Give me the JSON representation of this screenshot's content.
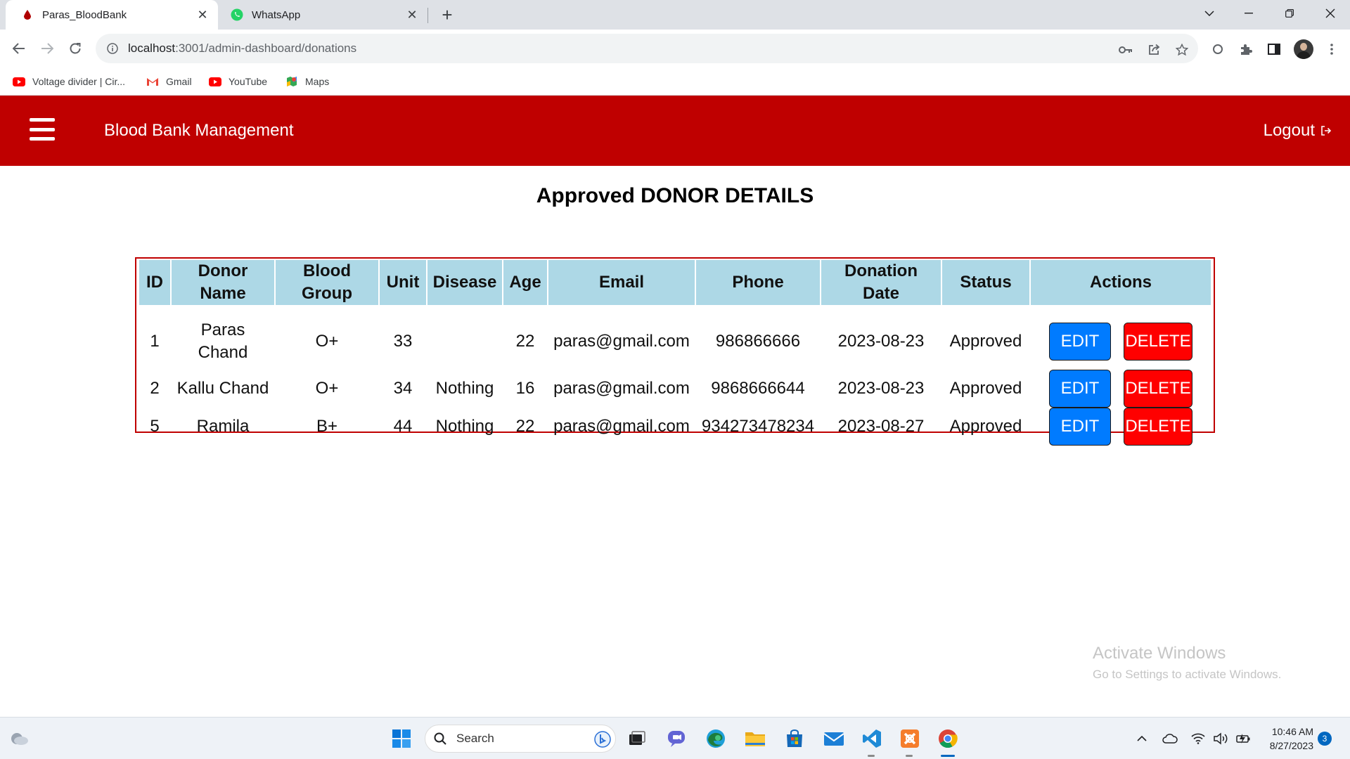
{
  "browser": {
    "tabs": [
      {
        "title": "Paras_BloodBank",
        "icon": "blood-drop-icon",
        "active": true
      },
      {
        "title": "WhatsApp",
        "icon": "whatsapp-icon",
        "active": false
      }
    ],
    "url_host": "localhost",
    "url_path": ":3001/admin-dashboard/donations",
    "bookmarks": [
      {
        "label": "Voltage divider | Cir...",
        "icon": "youtube-icon"
      },
      {
        "label": "Gmail",
        "icon": "gmail-icon"
      },
      {
        "label": "YouTube",
        "icon": "youtube-icon"
      },
      {
        "label": "Maps",
        "icon": "maps-icon"
      }
    ]
  },
  "header": {
    "brand": "Blood Bank Management",
    "logout_label": "Logout"
  },
  "page": {
    "title": "Approved DONOR DETAILS"
  },
  "table": {
    "headers": [
      "ID",
      "Donor Name",
      "Blood Group",
      "Unit",
      "Disease",
      "Age",
      "Email",
      "Phone",
      "Donation Date",
      "Status",
      "Actions"
    ],
    "rows": [
      {
        "id": "1",
        "name": "Paras Chand",
        "blood_group": "O+",
        "unit": "33",
        "disease": "",
        "age": "22",
        "email": "paras@gmail.com",
        "phone": "986866666",
        "date": "2023-08-23",
        "status": "Approved"
      },
      {
        "id": "2",
        "name": "Kallu Chand",
        "blood_group": "O+",
        "unit": "34",
        "disease": "Nothing",
        "age": "16",
        "email": "paras@gmail.com",
        "phone": "9868666644",
        "date": "2023-08-23",
        "status": "Approved"
      },
      {
        "id": "5",
        "name": "Ramila",
        "blood_group": "B+",
        "unit": "44",
        "disease": "Nothing",
        "age": "22",
        "email": "paras@gmail.com",
        "phone": "934273478234",
        "date": "2023-08-27",
        "status": "Approved"
      }
    ],
    "edit_label": "EDIT",
    "delete_label": "DELETE"
  },
  "watermark": {
    "line1": "Activate Windows",
    "line2": "Go to Settings to activate Windows."
  },
  "taskbar": {
    "search_placeholder": "Search",
    "time": "10:46 AM",
    "date": "8/27/2023",
    "notification_count": "3"
  },
  "colors": {
    "header_bg": "#bf0000",
    "table_header_bg": "#add8e6",
    "edit_button": "#007bff",
    "delete_button": "#ff0000"
  }
}
